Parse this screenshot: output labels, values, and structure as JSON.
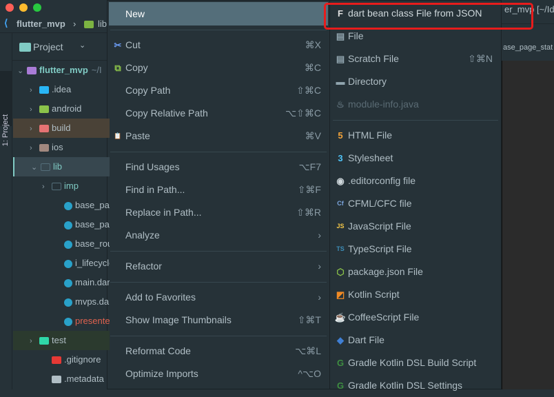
{
  "window": {
    "traffic_lights": [
      "#fe5f57",
      "#febc2e",
      "#28c840"
    ],
    "project_name": "flutter_mvp",
    "crumb_lib": "lib",
    "title_fragment": "er_mvp [~/Ide",
    "editor_tab_fragment": "ase_page_stat"
  },
  "sidebar": {
    "tool_window_label": "1: Project"
  },
  "project_panel": {
    "header": "Project",
    "tree": [
      {
        "label": "flutter_mvp",
        "suffix": "~/I",
        "depth": 0,
        "expand": "open",
        "icon": "module-folder-icon",
        "color": "#a97bd6",
        "text_color": "#80cbc4",
        "bold": true
      },
      {
        "label": ".idea",
        "depth": 1,
        "expand": "closed",
        "icon": "idea-folder-icon",
        "color": "#29b6f6"
      },
      {
        "label": "android",
        "depth": 1,
        "expand": "closed",
        "icon": "android-folder-icon",
        "color": "#8bc34a"
      },
      {
        "label": "build",
        "depth": 1,
        "expand": "closed",
        "icon": "build-folder-icon",
        "color": "#e57373",
        "bg": "#4a4237"
      },
      {
        "label": "ios",
        "depth": 1,
        "expand": "closed",
        "icon": "wrench-icon",
        "color": "#a1887f"
      },
      {
        "label": "lib",
        "depth": 1,
        "expand": "open",
        "icon": "folder-icon",
        "color": "#546e7a",
        "bg": "#37474f",
        "text_color": "#80cbc4"
      },
      {
        "label": "imp",
        "depth": 2,
        "expand": "closed",
        "icon": "folder-icon",
        "color": "#546e7a",
        "text_color": "#80cbc4"
      },
      {
        "label": "base_page",
        "depth": 3,
        "icon": "dart-file-icon",
        "color": "#29a1c9"
      },
      {
        "label": "base_page",
        "depth": 3,
        "icon": "dart-file-icon",
        "color": "#29a1c9"
      },
      {
        "label": "base_route",
        "depth": 3,
        "icon": "dart-file-icon",
        "color": "#29a1c9"
      },
      {
        "label": "i_lifecycle.",
        "depth": 3,
        "icon": "dart-file-icon",
        "color": "#29a1c9"
      },
      {
        "label": "main.dart",
        "depth": 3,
        "icon": "dart-file-icon",
        "color": "#29a1c9"
      },
      {
        "label": "mvps.dart",
        "depth": 3,
        "icon": "dart-file-icon",
        "color": "#29a1c9"
      },
      {
        "label": "presenter_",
        "depth": 3,
        "icon": "dart-file-icon",
        "color": "#29a1c9",
        "text_color": "#e0624f"
      },
      {
        "label": "test",
        "depth": 1,
        "expand": "closed",
        "icon": "test-folder-icon",
        "color": "#2fd8a7",
        "bg": "#2b3a2e"
      },
      {
        "label": ".gitignore",
        "depth": 2,
        "icon": "git-icon",
        "color": "#e53935"
      },
      {
        "label": ".metadata",
        "depth": 2,
        "icon": "text-file-icon",
        "color": "#b0bec5"
      }
    ]
  },
  "context_menu": {
    "items": [
      {
        "label": "New",
        "highlighted": true,
        "submenu": true
      },
      {
        "sep": true
      },
      {
        "label": "Cut",
        "shortcut": "⌘X",
        "icon": "scissors-icon",
        "glyph": "✂",
        "color": "#6b9bf2"
      },
      {
        "label": "Copy",
        "shortcut": "⌘C",
        "icon": "copy-icon",
        "glyph": "⧉",
        "color": "#8bc34a"
      },
      {
        "label": "Copy Path",
        "shortcut": "⇧⌘C"
      },
      {
        "label": "Copy Relative Path",
        "shortcut": "⌥⇧⌘C"
      },
      {
        "label": "Paste",
        "shortcut": "⌘V",
        "icon": "clipboard-icon",
        "glyph": "📋",
        "color": "#f2b84b"
      },
      {
        "sep": true
      },
      {
        "label": "Find Usages",
        "shortcut": "⌥F7"
      },
      {
        "label": "Find in Path...",
        "shortcut": "⇧⌘F"
      },
      {
        "label": "Replace in Path...",
        "shortcut": "⇧⌘R"
      },
      {
        "label": "Analyze",
        "submenu": true
      },
      {
        "sep": true
      },
      {
        "label": "Refactor",
        "submenu": true
      },
      {
        "sep": true
      },
      {
        "label": "Add to Favorites",
        "submenu": true
      },
      {
        "label": "Show Image Thumbnails",
        "shortcut": "⇧⌘T"
      },
      {
        "sep": true
      },
      {
        "label": "Reformat Code",
        "shortcut": "⌥⌘L"
      },
      {
        "label": "Optimize Imports",
        "shortcut": "^⌥O"
      }
    ]
  },
  "new_submenu": {
    "highlight_color": "#e81c1c",
    "items": [
      {
        "label": "dart bean class File from JSON",
        "icon": "f-plugin-icon",
        "glyph": "F",
        "color": "#e0e0e0",
        "highlighted": true
      },
      {
        "label": "File",
        "icon": "file-icon",
        "glyph": "▤",
        "color": "#90a4ae"
      },
      {
        "label": "Scratch File",
        "shortcut": "⇧⌘N",
        "icon": "scratch-file-icon",
        "glyph": "▤",
        "color": "#90a4ae"
      },
      {
        "label": "Directory",
        "icon": "folder-icon",
        "glyph": "▬",
        "color": "#90a4ae"
      },
      {
        "label": "module-info.java",
        "icon": "java-icon",
        "glyph": "♨",
        "color": "#5a6b74",
        "disabled": true
      },
      {
        "sep": true
      },
      {
        "label": "HTML File",
        "icon": "html5-icon",
        "glyph": "5",
        "color": "#f2a33a"
      },
      {
        "label": "Stylesheet",
        "icon": "css3-icon",
        "glyph": "3",
        "color": "#4fc3f7"
      },
      {
        "label": ".editorconfig file",
        "icon": "editorconfig-icon",
        "glyph": "◉",
        "color": "#cfd8dc"
      },
      {
        "label": "CFML/CFC file",
        "icon": "cfml-icon",
        "glyph": "Cf",
        "color": "#7da7e0"
      },
      {
        "label": "JavaScript File",
        "icon": "javascript-icon",
        "glyph": "JS",
        "color": "#f7c948"
      },
      {
        "label": "TypeScript File",
        "icon": "typescript-icon",
        "glyph": "TS",
        "color": "#3d8eb9"
      },
      {
        "label": "package.json File",
        "icon": "nodejs-icon",
        "glyph": "⬡",
        "color": "#8bc34a"
      },
      {
        "label": "Kotlin Script",
        "icon": "kotlin-icon",
        "glyph": "◩",
        "color": "#f08a24"
      },
      {
        "label": "CoffeeScript File",
        "icon": "coffeescript-icon",
        "glyph": "☕",
        "color": "#4fa3d9"
      },
      {
        "label": "Dart File",
        "icon": "dart-icon",
        "glyph": "◆",
        "color": "#3f7fd4"
      },
      {
        "label": "Gradle Kotlin DSL Build Script",
        "icon": "gradle-icon",
        "glyph": "G",
        "color": "#3e8e41"
      },
      {
        "label": "Gradle Kotlin DSL Settings",
        "icon": "gradle-icon",
        "glyph": "G",
        "color": "#3e8e41"
      }
    ]
  }
}
